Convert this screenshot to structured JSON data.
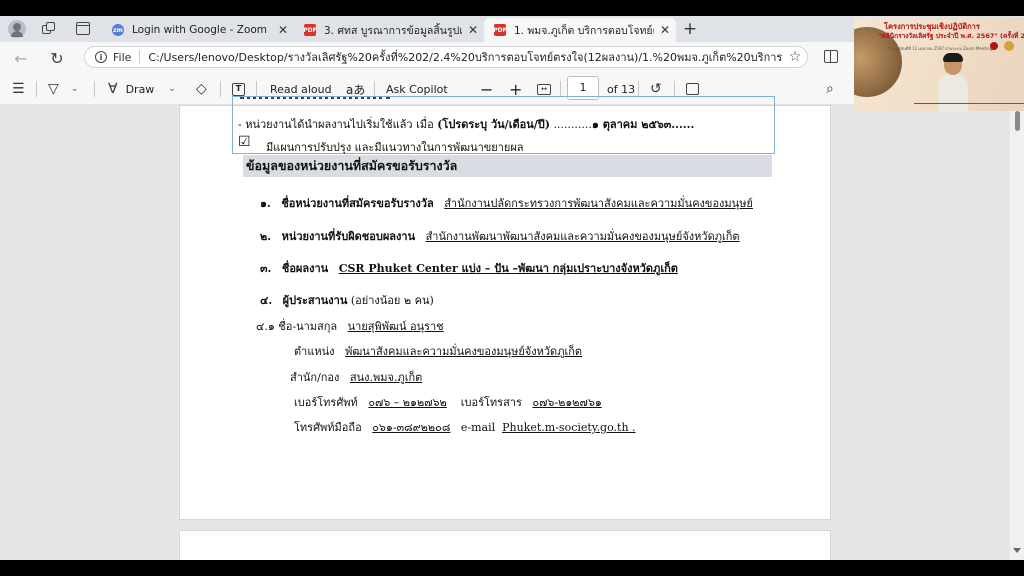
{
  "tabs": [
    {
      "label": "Login with Google - Zoom",
      "icon": "zoom-icon"
    },
    {
      "label": "3. ศทส บูรณาการข้อมูลสิ้นรูปแบบดิจิทัล",
      "icon": "pdf-icon"
    },
    {
      "label": "1. พมจ.ภูเก็ต บริการตอบโจทย์ตรงใจ.pdf",
      "icon": "pdf-icon"
    }
  ],
  "address": {
    "scheme": "File",
    "path": "C:/Users/lenovo/Desktop/รางวัลเลิศรัฐ%20ครั้งที่%202/2.4%20บริการตอบโจทย์ตรงใจ(12ผลงาน)/1.%20พมจ.ภูเก็ต%20บริการตอบโจทย์ตรงใจ..."
  },
  "toolbar": {
    "draw": "Draw",
    "read_aloud": "Read aloud",
    "ask_copilot": "Ask Copilot",
    "page_current": "1",
    "page_total": "of 13"
  },
  "doc": {
    "line_top": "- หน่วยงานได้นำผลงานไปเริ่มใช้แล้ว เมื่อ",
    "line_top_bold": "(โปรดระบุ วัน/เดือน/ปี)",
    "line_top_dots": "...........",
    "line_top_date": "๑ ตุลาคม ๒๕๖๓......",
    "check_mark": "☑",
    "check_text": "มีแผนการปรับปรุง และมีแนวทางในการพัฒนาขยายผล",
    "section_heading": "ข้อมูลของหน่วยงานที่สมัครขอรับรางวัล",
    "items": [
      {
        "num": "๑.",
        "label": "ชื่อหน่วยงานที่สมัครขอรับรางวัล",
        "value": "สำนักงานปลัดกระทรวงการพัฒนาสังคมและความมั่นคงของมนุษย์"
      },
      {
        "num": "๒.",
        "label": "หน่วยงานที่รับผิดชอบผลงาน",
        "value": "สำนักงานพัฒนาพัฒนาสังคมและความมั่นคงของมนุษย์จังหวัดภูเก็ต"
      },
      {
        "num": "๓.",
        "label": "ชื่อผลงาน",
        "value": "CSR Phuket Center แบ่ง – ปัน –พัฒนา กลุ่มเปราะบางจังหวัดภูเก็ต"
      }
    ],
    "coordinator_num": "๔.",
    "coordinator_label": "ผู้ประสานงาน",
    "coordinator_note": "(อย่างน้อย ๒ คน)",
    "contact": {
      "name_label": "๔.๑ ชื่อ-นามสกุล",
      "name": "นายสุพิพัฒน์ อนุราช",
      "position_label": "ตำแหน่ง",
      "position": "พัฒนาสังคมและความมั่นคงของมนุษย์จังหวัดภูเก็ต",
      "office_label": "สำนัก/กอง",
      "office": "สนง.พมจ.ภูเก็ต",
      "phone_label": "เบอร์โทรศัพท์",
      "phone": "๐๗๖ – ๒๑๒๗๖๒",
      "fax_label": "เบอร์โทรสาร",
      "fax": "๐๗๖-๒๑๒๗๖๑",
      "mobile_label": "โทรศัพท์มือถือ",
      "mobile": "๐๖๑-๓๘๙๒๒๐๘",
      "email_label": "e-mail",
      "email": "Phuket.m-society.go.th ."
    }
  },
  "zoom_overlay": {
    "title_line1": "โครงการประชุมเชิงปฏิบัติการ",
    "title_line2": "\"คลินิกรางวัลเลิศรัฐ ประจำปี พ.ศ. 2567\" (ครั้งที่ 2)",
    "sub_line": "วันพฤหัสบดีที่ 12 เมษายน 2567  ผ่านระบบ Zoom Meeting"
  },
  "colors": {
    "tab_bar": "#dfe3e8",
    "active_tab": "#f7f7f7",
    "heading_bg": "#d9dde3",
    "box_border": "#7fb0da",
    "pdf_icon": "#d9342b",
    "zoom_icon": "#5b7bd5"
  }
}
